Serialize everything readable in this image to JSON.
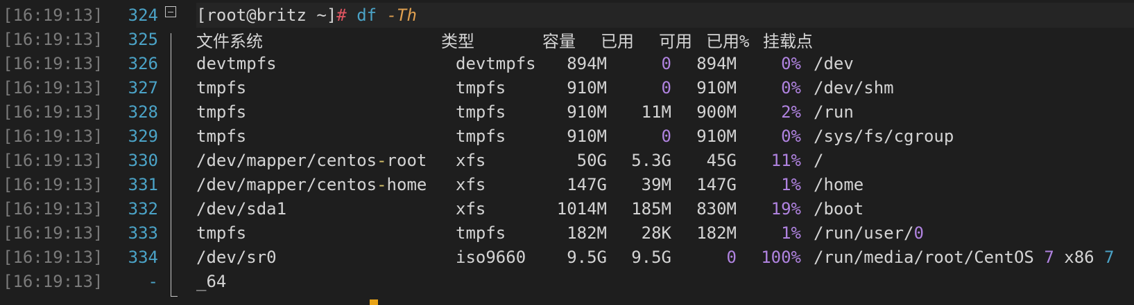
{
  "prompt": {
    "user_host": "[root@britz ~]",
    "hash": "#",
    "command": "df",
    "option": "-Th"
  },
  "header": {
    "filesystem": "文件系统",
    "type": "类型",
    "size": "容量",
    "used": "已用",
    "avail": "可用",
    "use_pct": "已用%",
    "mount": "挂载点"
  },
  "rows": [
    {
      "ts": "[16:19:13]",
      "ln": "324"
    },
    {
      "ts": "[16:19:13]",
      "ln": "325"
    },
    {
      "ts": "[16:19:13]",
      "ln": "326",
      "fs": "devtmpfs",
      "type": "devtmpfs",
      "size": "894M",
      "used": "0",
      "avail": "894M",
      "pct": "0%",
      "mount": "/dev"
    },
    {
      "ts": "[16:19:13]",
      "ln": "327",
      "fs": "tmpfs",
      "type": "tmpfs",
      "size": "910M",
      "used": "0",
      "avail": "910M",
      "pct": "0%",
      "mount": "/dev/shm"
    },
    {
      "ts": "[16:19:13]",
      "ln": "328",
      "fs": "tmpfs",
      "type": "tmpfs",
      "size": "910M",
      "used": "11M",
      "avail": "900M",
      "pct": "2%",
      "mount": "/run"
    },
    {
      "ts": "[16:19:13]",
      "ln": "329",
      "fs": "tmpfs",
      "type": "tmpfs",
      "size": "910M",
      "used": "0",
      "avail": "910M",
      "pct": "0%",
      "mount": "/sys/fs/cgroup"
    },
    {
      "ts": "[16:19:13]",
      "ln": "330",
      "fs_a": "/dev/mapper/centos",
      "fs_dash": "-",
      "fs_b": "root",
      "type": "xfs",
      "size": "50G",
      "used": "5.3G",
      "avail": "45G",
      "pct": "11%",
      "mount": "/"
    },
    {
      "ts": "[16:19:13]",
      "ln": "331",
      "fs_a": "/dev/mapper/centos",
      "fs_dash": "-",
      "fs_b": "home",
      "type": "xfs",
      "size": "147G",
      "used": "39M",
      "avail": "147G",
      "pct": "1%",
      "mount": "/home"
    },
    {
      "ts": "[16:19:13]",
      "ln": "332",
      "fs": "/dev/sda1",
      "type": "xfs",
      "size": "1014M",
      "used": "185M",
      "avail": "830M",
      "pct": "19%",
      "mount": "/boot"
    },
    {
      "ts": "[16:19:13]",
      "ln": "333",
      "fs": "tmpfs",
      "type": "tmpfs",
      "size": "182M",
      "used": "28K",
      "avail": "182M",
      "pct": "1%",
      "mount_a": "/run/user/",
      "mount_b": "0"
    },
    {
      "ts": "[16:19:13]",
      "ln": "334",
      "fs": "/dev/sr0",
      "type": "iso9660",
      "size": "9.5G",
      "used": "9.5G",
      "avail": "0",
      "pct": "100%",
      "mount_a": "/run/media/root/CentOS ",
      "mount_b": "7",
      "mount_c": " x86 ",
      "mount_d": "7"
    },
    {
      "ts": "[16:19:13]",
      "ln": "-",
      "cont": "_64"
    }
  ]
}
